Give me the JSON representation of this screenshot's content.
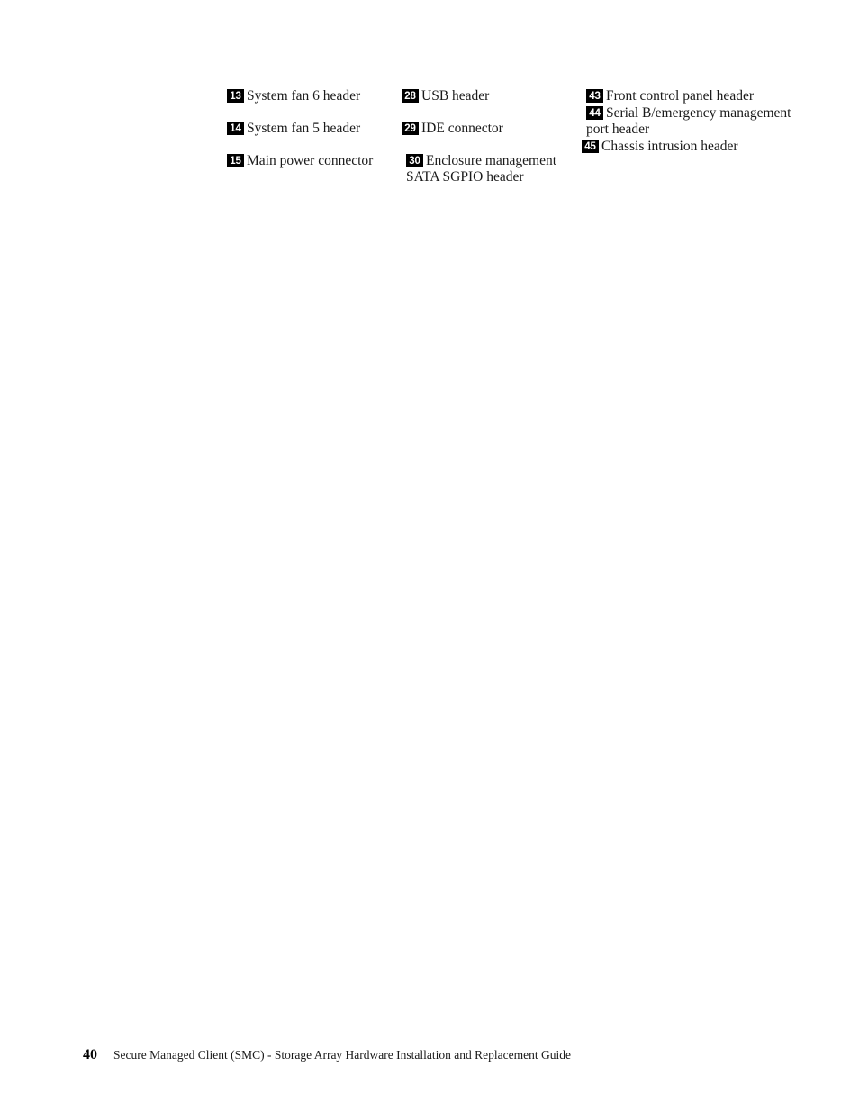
{
  "document": {
    "page_number": "40",
    "footer_title": "Secure Managed Client (SMC) - Storage Array Hardware Installation and Replacement Guide"
  },
  "legend": {
    "columns": [
      {
        "items": [
          {
            "number": "13",
            "label": "System fan 6 header"
          },
          {
            "number": "14",
            "label": "System fan 5 header"
          },
          {
            "number": "15",
            "label": "Main power connector"
          }
        ]
      },
      {
        "items": [
          {
            "number": "28",
            "label": "USB header"
          },
          {
            "number": "29",
            "label": "IDE connector"
          },
          {
            "number": "30",
            "label": "Enclosure management SATA SGPIO header"
          }
        ]
      },
      {
        "items": [
          {
            "number": "43",
            "label": "Front control panel header"
          },
          {
            "number": "44",
            "label": "Serial B/emergency management port header"
          },
          {
            "number": "45",
            "label": "Chassis intrusion header"
          }
        ]
      }
    ]
  }
}
